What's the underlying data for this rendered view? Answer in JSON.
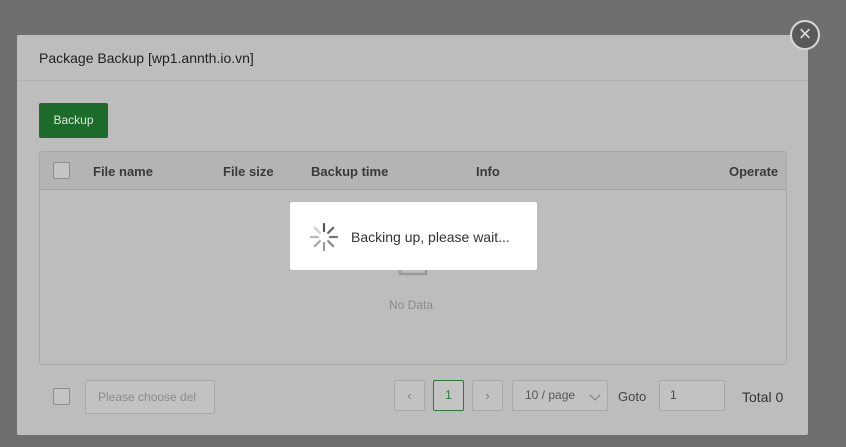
{
  "dialog": {
    "title": "Package Backup [wp1.annth.io.vn]",
    "close_label": "×"
  },
  "toolbar": {
    "backup_label": "Backup"
  },
  "table": {
    "columns": [
      "File name",
      "File size",
      "Backup time",
      "Info",
      "Operate"
    ],
    "empty_text": "No Data"
  },
  "footer": {
    "delete_placeholder": "Please choose del",
    "prev_icon": "‹",
    "current_page": "1",
    "next_icon": "›",
    "page_size": "10 / page",
    "goto_label": "Goto",
    "goto_value": "1",
    "total": "Total 0"
  },
  "loading": {
    "text": "Backing up, please wait..."
  },
  "colors": {
    "backup_button": "#1d6b2a",
    "current_page_border": "#2a7a38",
    "overlay": "#6f6f6f"
  }
}
